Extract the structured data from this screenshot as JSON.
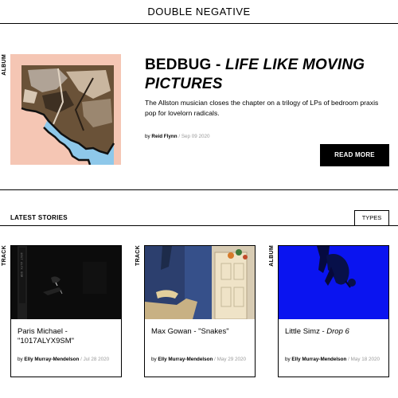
{
  "site": {
    "title": "DOUBLE NEGATIVE"
  },
  "hero": {
    "type_label": "ALBUM",
    "title_plain": "BEDBUG - ",
    "title_italic": "LIFE LIKE MOVING PICTURES",
    "description": "The Allston musician closes the chapter on a trilogy of LPs of bedroom praxis pop for lovelorn radicals.",
    "byline_prefix": "by",
    "author": "Reid Flynn",
    "separator": "/",
    "date": "Sep 09 2020",
    "read_more_label": "READ MORE"
  },
  "latest": {
    "title": "LATEST STORIES",
    "types_label": "TYPES",
    "cards": [
      {
        "type_label": "TRACK",
        "title_plain": " Paris Michael - \"1017ALYX9SM\"",
        "title_italic": "",
        "byline_prefix": "by",
        "author": "Elly Murray-Mendelson",
        "separator": "/",
        "date": "Jul 28 2020"
      },
      {
        "type_label": "TRACK",
        "title_plain": "Max Gowan - \"Snakes\"",
        "title_italic": "",
        "byline_prefix": "by",
        "author": "Elly Murray-Mendelson",
        "separator": "/",
        "date": "May 29 2020"
      },
      {
        "type_label": "ALBUM",
        "title_plain": "Little Simz - ",
        "title_italic": "Drop 6",
        "byline_prefix": "by",
        "author": "Elly Murray-Mendelson",
        "separator": "/",
        "date": "May 18 2020"
      }
    ]
  },
  "colors": {
    "accent": "#000000",
    "hero_art_bg": "#f5c6b4",
    "water": "#8ec8ea",
    "muted": "#9a9a9a",
    "album_blue": "#0a14f0"
  }
}
